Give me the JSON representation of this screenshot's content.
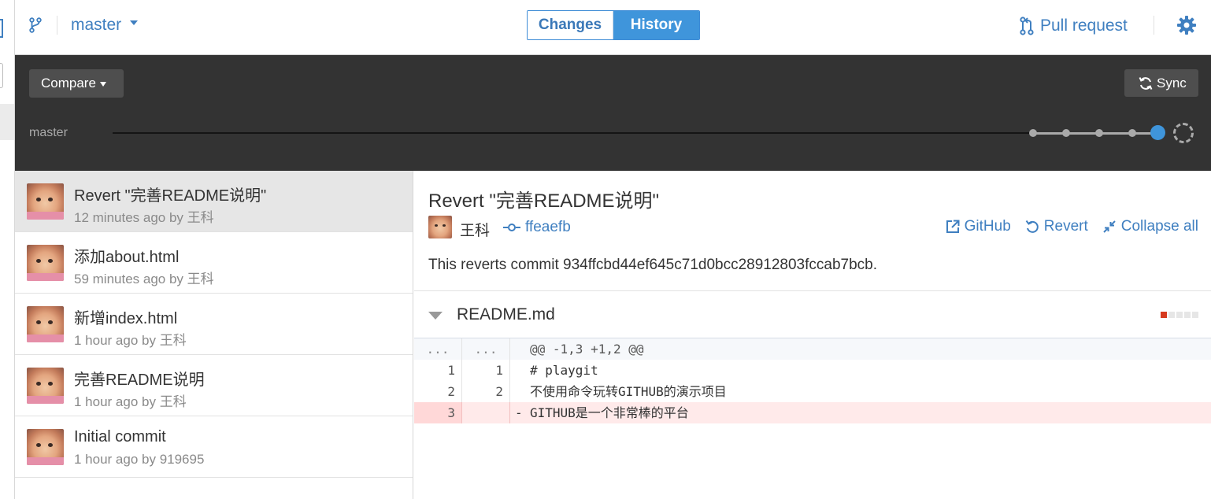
{
  "toolbar": {
    "branch": "master",
    "tabs": [
      "Changes",
      "History"
    ],
    "active_tab": "History",
    "pull_request_label": "Pull request"
  },
  "banner": {
    "compare_label": "Compare",
    "sync_label": "Sync",
    "timeline_branch": "master",
    "timeline_commit_count": 6
  },
  "commits": [
    {
      "title": "Revert \"完善README说明\"",
      "meta": "12 minutes ago by 王科",
      "selected": true
    },
    {
      "title": "添加about.html",
      "meta": "59 minutes ago by 王科",
      "selected": false
    },
    {
      "title": "新增index.html",
      "meta": "1 hour ago by 王科",
      "selected": false
    },
    {
      "title": "完善README说明",
      "meta": "1 hour ago by 王科",
      "selected": false
    },
    {
      "title": "Initial commit",
      "meta": "1 hour ago by 919695",
      "selected": false
    }
  ],
  "detail": {
    "title": "Revert \"完善README说明\"",
    "author": "王科",
    "sha": "ffeaefb",
    "actions": {
      "github": "GitHub",
      "revert": "Revert",
      "collapse": "Collapse all"
    },
    "description": "This reverts commit 934ffcbd44ef645c71d0bcc28912803fccab7bcb."
  },
  "file": {
    "name": "README.md",
    "diff": [
      {
        "type": "hunk",
        "old": "...",
        "new": "...",
        "mark": "",
        "code": "@@ -1,3 +1,2 @@"
      },
      {
        "type": "context",
        "old": "1",
        "new": "1",
        "mark": "",
        "code": "# playgit"
      },
      {
        "type": "context",
        "old": "2",
        "new": "2",
        "mark": "",
        "code": "不使用命令玩转GITHUB的演示项目"
      },
      {
        "type": "del",
        "old": "3",
        "new": "",
        "mark": "-",
        "code": "GITHUB是一个非常棒的平台"
      }
    ]
  },
  "colors": {
    "accent": "#3f95db",
    "link": "#3f7fc0",
    "banner_bg": "#333333",
    "deletion_bg": "#ffeaea"
  }
}
